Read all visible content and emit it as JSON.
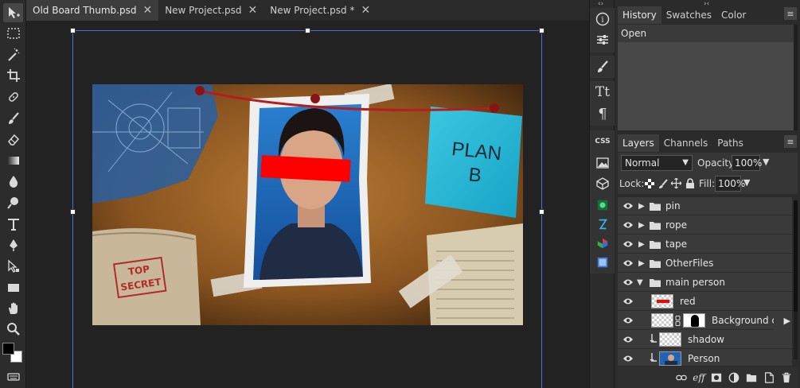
{
  "tabs": [
    {
      "label": "Old Board Thumb.psd",
      "active": true
    },
    {
      "label": "New Project.psd",
      "active": false
    },
    {
      "label": "New Project.psd *",
      "active": false
    }
  ],
  "close_glyph": "✕",
  "artwork": {
    "note_text": "PLAN\nB",
    "stamp_text": "TOP\nSECRET"
  },
  "history_panel": {
    "tabs": [
      "History",
      "Swatches",
      "Color"
    ],
    "items": [
      "Open"
    ]
  },
  "layers_panel": {
    "tabs": [
      "Layers",
      "Channels",
      "Paths"
    ],
    "blend_mode": "Normal",
    "opacity_label": "Opacity:",
    "opacity_value": "100%",
    "lock_label": "Lock:",
    "fill_label": "Fill:",
    "fill_value": "100%",
    "layers": [
      {
        "name": "pin",
        "type": "folder"
      },
      {
        "name": "rope",
        "type": "folder"
      },
      {
        "name": "tape",
        "type": "folder"
      },
      {
        "name": "OtherFiles",
        "type": "folder"
      },
      {
        "name": "main person",
        "type": "folder-open"
      },
      {
        "name": "red",
        "type": "layer"
      },
      {
        "name": "Background copy",
        "type": "masked"
      },
      {
        "name": "shadow",
        "type": "clipped"
      },
      {
        "name": "Person",
        "type": "clipped"
      }
    ],
    "footer_eff": "eff"
  },
  "side_strip": {
    "css_label": "CSS",
    "text_tool_glyph": "Tt",
    "paragraph_glyph": "¶",
    "info_glyph": "i"
  },
  "colors": {
    "accent_selection": "#4a6fe0",
    "panel_bg": "#2b2b2b",
    "workspace_bg": "#222222"
  }
}
